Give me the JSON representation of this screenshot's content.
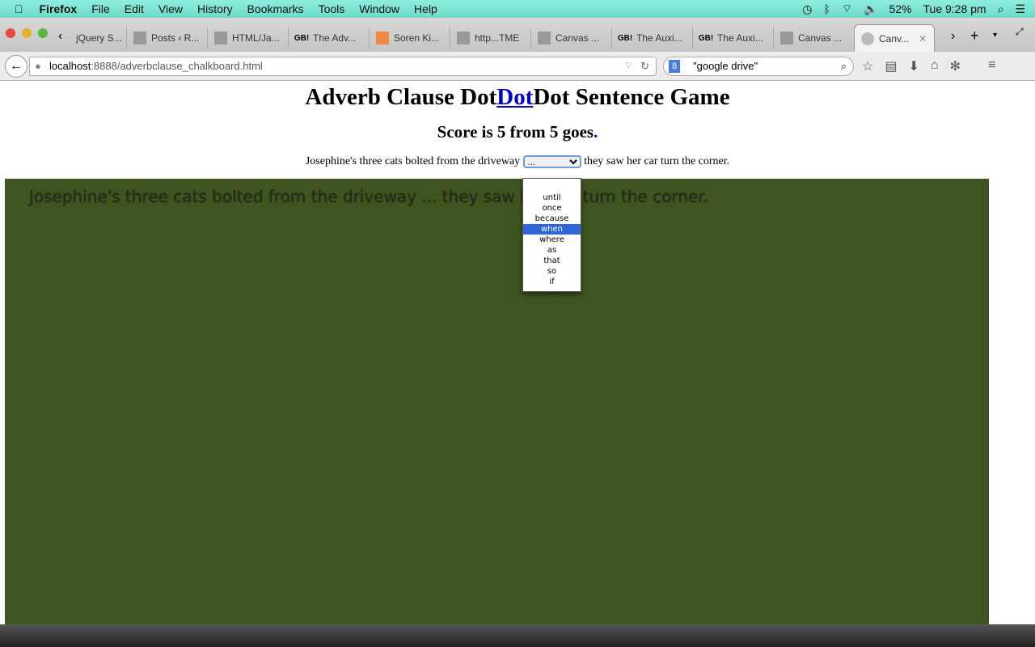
{
  "menubar": {
    "app": "Firefox",
    "items": [
      "File",
      "Edit",
      "View",
      "History",
      "Bookmarks",
      "Tools",
      "Window",
      "Help"
    ],
    "battery": "52%",
    "clock": "Tue 9:28 pm"
  },
  "tabs": [
    {
      "label": "jQuery S..."
    },
    {
      "label": "Posts ‹ R..."
    },
    {
      "label": "HTML/Ja..."
    },
    {
      "label": "The Adv...",
      "icon": "GB!"
    },
    {
      "label": "Soren Ki..."
    },
    {
      "label": "http...TME"
    },
    {
      "label": "Canvas ..."
    },
    {
      "label": "The Auxi...",
      "icon": "GB!"
    },
    {
      "label": "The Auxi...",
      "icon": "GB!"
    },
    {
      "label": "Canvas ..."
    },
    {
      "label": "Canv...",
      "active": true
    }
  ],
  "nav": {
    "url_host": "localhost",
    "url_rest": ":8888/adverbclause_chalkboard.html",
    "search": "\"google drive\""
  },
  "page": {
    "title_pre": "Adverb Clause Dot",
    "title_link": "Dot",
    "title_post": "Dot Sentence Game",
    "score": "Score is 5 from 5 goes",
    "score_link": ".",
    "sentence_pre": "Josephine's three cats bolted from the driveway",
    "select_value": "...",
    "sentence_post": "they saw her car turn the corner.",
    "canvas_text": "Josephine's three cats bolted from the driveway ... they saw her car turn the corner.",
    "options": [
      "",
      "until",
      "once",
      "because",
      "when",
      "where",
      "as",
      "that",
      "so",
      "if",
      "..."
    ],
    "highlighted_option": "when"
  },
  "colors": {
    "chalkboard": "#405420",
    "highlight": "#2f66d4",
    "link": "#0000cc"
  }
}
